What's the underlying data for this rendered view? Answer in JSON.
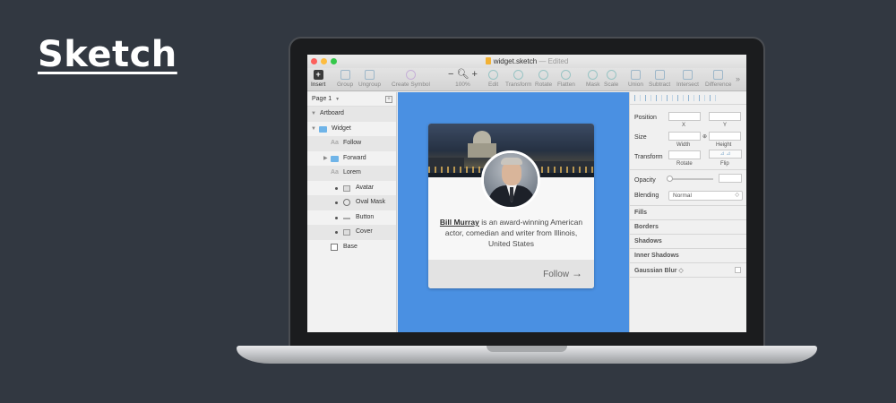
{
  "brand": {
    "title": "Sketch"
  },
  "window": {
    "filename": "widget.sketch",
    "separator": "—",
    "status": "Edited"
  },
  "toolbar": {
    "insert": "Insert",
    "group": "Group",
    "ungroup": "Ungroup",
    "create_symbol": "Create Symbol",
    "zoom_minus": "−",
    "zoom_plus": "+",
    "zoom_level": "100%",
    "edit": "Edit",
    "transform": "Transform",
    "rotate": "Rotate",
    "flatten": "Flatten",
    "mask": "Mask",
    "scale": "Scale",
    "union": "Union",
    "subtract": "Subtract",
    "intersect": "Intersect",
    "difference": "Difference",
    "more": "»"
  },
  "layers": {
    "page": "Page 1",
    "artboard": "Artboard",
    "items": {
      "widget": "Widget",
      "follow": "Follow",
      "forward": "Forward",
      "lorem": "Lorem",
      "avatar": "Avatar",
      "oval_mask": "Oval Mask",
      "button": "Button",
      "cover": "Cover",
      "base": "Base"
    }
  },
  "card": {
    "name": "Bill Murray",
    "bio_rest": " is an award-winning American actor, comedian and writer from Illinois, United States",
    "follow_label": "Follow",
    "follow_arrow": "→"
  },
  "inspector": {
    "position": "Position",
    "x": "X",
    "y": "Y",
    "size": "Size",
    "width": "Width",
    "height": "Height",
    "lock": "⊕",
    "transform": "Transform",
    "rotate": "Rotate",
    "flip": "Flip",
    "flip_icons": "⊿ ⊿",
    "opacity": "Opacity",
    "blending": "Blending",
    "blending_value": "Normal",
    "fills": "Fills",
    "borders": "Borders",
    "shadows": "Shadows",
    "inner_shadows": "Inner Shadows",
    "gaussian_blur": "Gaussian Blur",
    "blur_chevron": "◇"
  },
  "colors": {
    "background": "#323841",
    "canvas": "#4a90e2",
    "folder": "#6fb4e8"
  }
}
